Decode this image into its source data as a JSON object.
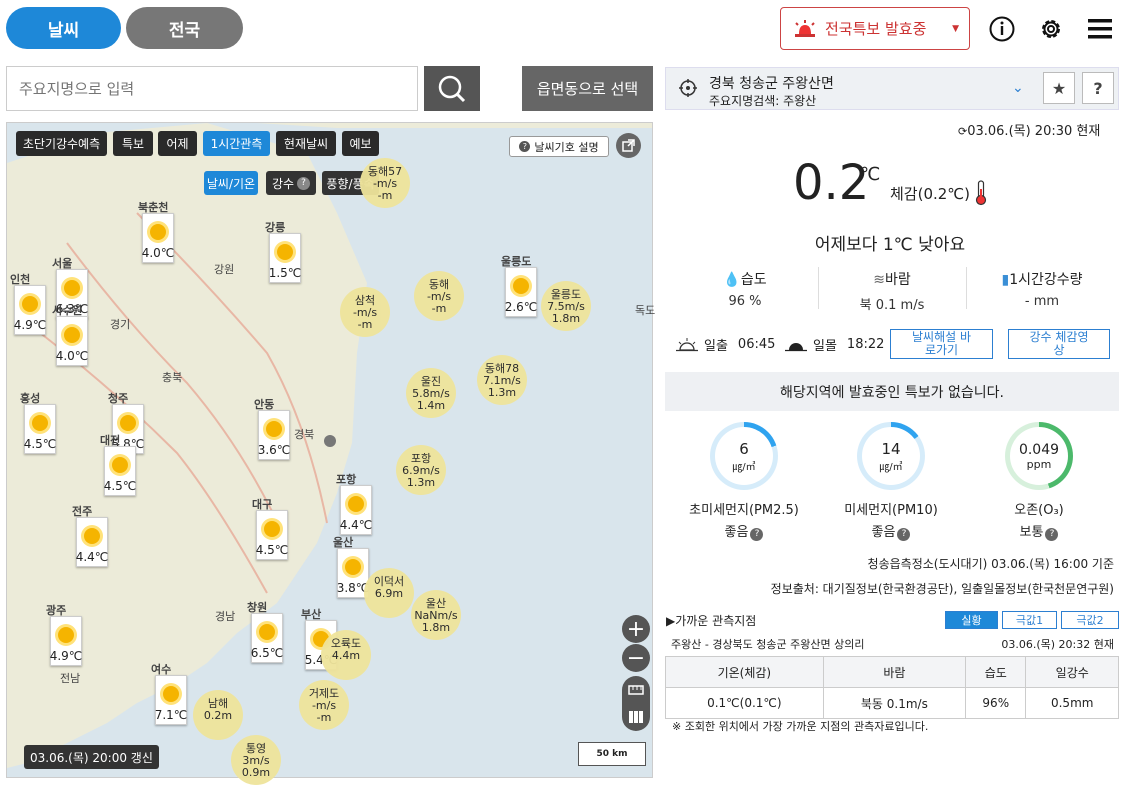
{
  "top": {
    "tab_weather": "날씨",
    "tab_nation": "전국",
    "alert_label": "전국특보 발효중"
  },
  "search": {
    "placeholder": "주요지명으로 입력",
    "emd_button": "읍면동으로 선택"
  },
  "map": {
    "tabs": [
      "초단기강수예측",
      "특보",
      "어제",
      "1시간관측",
      "현재날씨",
      "예보"
    ],
    "active_tab": "1시간관측",
    "sub_tabs": [
      "날씨/기온",
      "강수",
      "풍향/풍속"
    ],
    "legend_button": "날씨기호 설명",
    "updated": "03.06.(목) 20:00 갱신",
    "scale": "50 km",
    "stations": [
      {
        "name": "북춘천",
        "temp": "4.0℃"
      },
      {
        "name": "강릉",
        "temp": "1.5℃"
      },
      {
        "name": "인천",
        "temp": "4.9℃"
      },
      {
        "name": "서울",
        "temp": "6.3℃"
      },
      {
        "name": "서수원",
        "temp": "4.0℃"
      },
      {
        "name": "울릉도",
        "temp": "2.6℃"
      },
      {
        "name": "홍성",
        "temp": "4.5℃"
      },
      {
        "name": "청주",
        "temp": "5.8℃"
      },
      {
        "name": "대전",
        "temp": "4.5℃"
      },
      {
        "name": "안동",
        "temp": "3.6℃"
      },
      {
        "name": "포항",
        "temp": "4.4℃"
      },
      {
        "name": "대구",
        "temp": "4.5℃"
      },
      {
        "name": "전주",
        "temp": "4.4℃"
      },
      {
        "name": "울산",
        "temp": "3.8℃"
      },
      {
        "name": "광주",
        "temp": "4.9℃"
      },
      {
        "name": "창원",
        "temp": "6.5℃"
      },
      {
        "name": "부산",
        "temp": "5.4℃"
      },
      {
        "name": "여수",
        "temp": "7.1℃"
      }
    ],
    "sea_buoys": [
      {
        "name": "동해57",
        "wind": "-m/s",
        "wave": "-m"
      },
      {
        "name": "삼척",
        "wind": "-m/s",
        "wave": "-m"
      },
      {
        "name": "동해",
        "wind": "-m/s",
        "wave": "-m"
      },
      {
        "name": "울릉도",
        "wind": "7.5m/s",
        "wave": "1.8m"
      },
      {
        "name": "울진",
        "wind": "5.8m/s",
        "wave": "1.4m"
      },
      {
        "name": "동해78",
        "wind": "7.1m/s",
        "wave": "1.3m"
      },
      {
        "name": "포항",
        "wind": "6.9m/s",
        "wave": "1.3m"
      },
      {
        "name": "이덕서",
        "wind": "",
        "wave": "6.9m"
      },
      {
        "name": "울산",
        "wind": "NaNm/s",
        "wave": "1.8m"
      },
      {
        "name": "오륙도",
        "wind": "",
        "wave": "4.4m"
      },
      {
        "name": "거제도",
        "wind": "-m/s",
        "wave": "-m"
      },
      {
        "name": "남해",
        "wind": "",
        "wave": "0.2m"
      },
      {
        "name": "통영",
        "wind": "3m/s",
        "wave": "0.9m"
      }
    ],
    "places": [
      "강원",
      "경기",
      "충북",
      "경북",
      "경남",
      "전남",
      "독도"
    ]
  },
  "location": {
    "name": "경북 청송군 주왕산면",
    "sub": "주요지명검색: 주왕산"
  },
  "current": {
    "time": "03.06.(목) 20:30 현재",
    "temp": "0.2",
    "unit": "℃",
    "feels": "체감(0.2℃)",
    "compare": "어제보다 1℃ 낮아요",
    "humidity_label": "습도",
    "humidity": "96 %",
    "wind_label": "바람",
    "wind": "북 0.1 m/s",
    "rain_label": "1시간강수량",
    "rain": "- mm",
    "sunrise_label": "일출",
    "sunrise": "06:45",
    "sunset_label": "일몰",
    "sunset": "18:22",
    "btn_commentary": "날씨해설 바로가기",
    "btn_rain_video": "강수 체감영상"
  },
  "notice": "해당지역에 발효중인 특보가 없습니다.",
  "air": {
    "pm25": {
      "value": "6",
      "unit": "㎍/㎥",
      "name": "초미세먼지(PM2.5)",
      "grade": "좋음",
      "fill": 0.2
    },
    "pm10": {
      "value": "14",
      "unit": "㎍/㎥",
      "name": "미세먼지(PM10)",
      "grade": "좋음",
      "fill": 0.15
    },
    "o3": {
      "value": "0.049",
      "unit": "ppm",
      "name": "오존(O₃)",
      "grade": "보통",
      "fill": 0.45
    },
    "station": "청송읍측정소(도시대기) 03.06.(목) 16:00 기준",
    "source": "정보출처: 대기질정보(한국환경공단), 일출일몰정보(한국천문연구원)"
  },
  "nearby": {
    "title": "▶가까운 관측지점",
    "tabs": [
      "실황",
      "극값1",
      "극값2"
    ],
    "station": "주왕산 - 경상북도 청송군 주왕산면 상의리",
    "time": "03.06.(목) 20:32 현재",
    "headers": [
      "기온(체감)",
      "바람",
      "습도",
      "일강수"
    ],
    "values": [
      "0.1℃(0.1℃)",
      "북동 0.1m/s",
      "96%",
      "0.5mm"
    ],
    "note": "※ 조회한 위치에서 가장 가까운 지점의 관측자료입니다."
  },
  "colors": {
    "accent": "#1e88d8",
    "alert": "#cc3333",
    "pm_ring": "#2fa3ef",
    "o3_ring": "#4cb96b"
  }
}
